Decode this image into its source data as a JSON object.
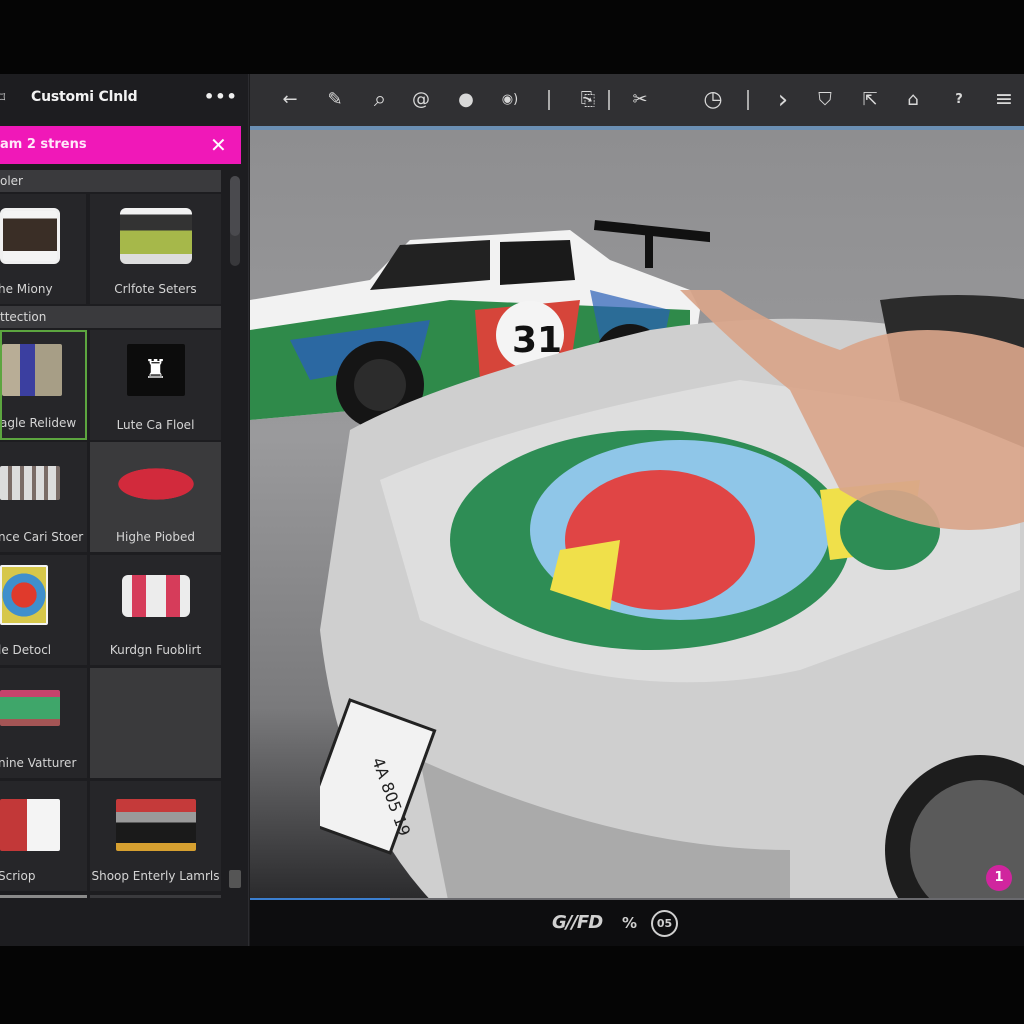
{
  "sidebar": {
    "title": "Customi Clnld",
    "more_label": "•••",
    "banner": {
      "text": "am 2 strens",
      "close_label": "✕",
      "color": "#f018b8"
    },
    "sections": [
      {
        "label": "oler"
      },
      {
        "label": "ttection"
      }
    ],
    "tiles": [
      {
        "label": "he Miony",
        "thumb": "white-car-rear"
      },
      {
        "label": "Crlfote Seters",
        "thumb": "green-car-rear"
      },
      {
        "label": "agle Relidew",
        "thumb": "person-photo",
        "selected": true
      },
      {
        "label": "Lute Ca Floel",
        "thumb": "robot-icon"
      },
      {
        "label": "nce Cari Stoer",
        "thumb": "car-lineup"
      },
      {
        "label": "Highe Piobed",
        "thumb": "red-car"
      },
      {
        "label": "le Detocl",
        "thumb": "decal-art"
      },
      {
        "label": "Kurdgn Fuoblirt",
        "thumb": "white-decal-car"
      },
      {
        "label": "nine Vatturer",
        "thumb": "green-race-car"
      },
      {
        "label": "",
        "thumb": "empty"
      },
      {
        "label": "Scriop",
        "thumb": "red-cars-photo"
      },
      {
        "label": "Shoop Enterly Lamrls",
        "thumb": "street-car-photo"
      }
    ]
  },
  "toolbar": {
    "tools": [
      {
        "name": "back",
        "glyph": "←"
      },
      {
        "name": "pen",
        "glyph": "✎"
      },
      {
        "name": "search",
        "glyph": "⌕"
      },
      {
        "name": "at",
        "glyph": "@"
      },
      {
        "name": "dial",
        "glyph": "●"
      },
      {
        "name": "sound",
        "glyph": "◉)"
      },
      {
        "name": "layer",
        "glyph": "⎘"
      },
      {
        "name": "cut",
        "glyph": "✂"
      },
      {
        "name": "clock",
        "glyph": "◷"
      },
      {
        "name": "forward",
        "glyph": "›"
      },
      {
        "name": "shield-download",
        "glyph": "⛉"
      },
      {
        "name": "export",
        "glyph": "⇱"
      },
      {
        "name": "gallery",
        "glyph": "⌂"
      },
      {
        "name": "help-card",
        "glyph": "?"
      },
      {
        "name": "menu",
        "glyph": "≡"
      }
    ]
  },
  "canvas": {
    "car1_number": "31",
    "plate_text": "4A 805 19",
    "badge_count": "1"
  },
  "bottom": {
    "brand": "G//FD",
    "percent_label": "%",
    "circle_value": "05"
  },
  "colors": {
    "accent_pink": "#f018b8",
    "badge_pink": "#d0259e",
    "selected_green": "#5ca53f",
    "progress_blue": "#3b7fd0"
  }
}
